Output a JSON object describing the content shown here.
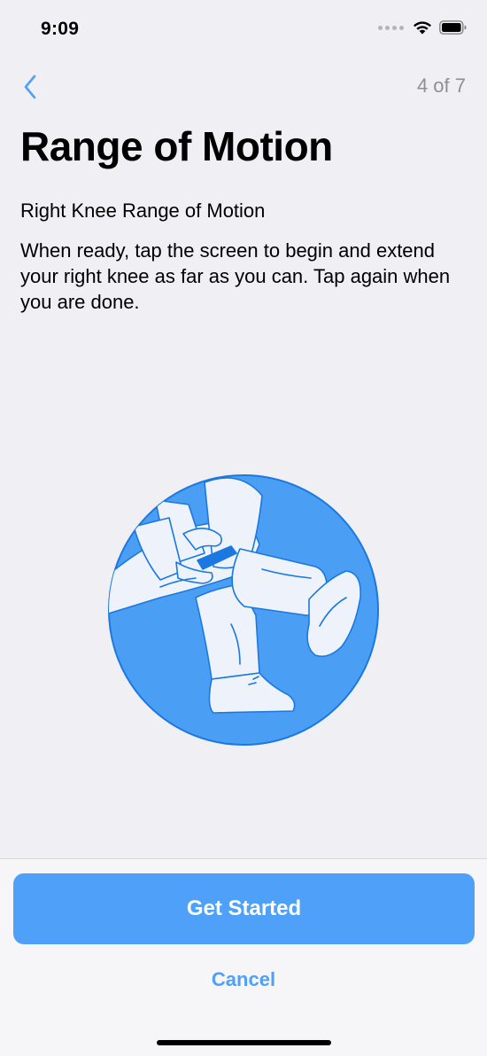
{
  "status_bar": {
    "time": "9:09",
    "icons": [
      "signal-dots-icon",
      "wifi-icon",
      "battery-icon"
    ]
  },
  "nav": {
    "back_icon": "chevron-left-icon",
    "step": "4 of 7"
  },
  "content": {
    "title": "Range of Motion",
    "subtitle": "Right Knee Range of Motion",
    "description": "When ready, tap the screen to begin and extend your right knee as far as you can. Tap again when you are done.",
    "illustration": "knee-extension-illustration"
  },
  "footer": {
    "primary_label": "Get Started",
    "cancel_label": "Cancel"
  },
  "colors": {
    "accent": "#4fa0f9",
    "illustration_blue": "#4a9ff5",
    "background": "#efeff4",
    "step_gray": "#8e8e93"
  }
}
